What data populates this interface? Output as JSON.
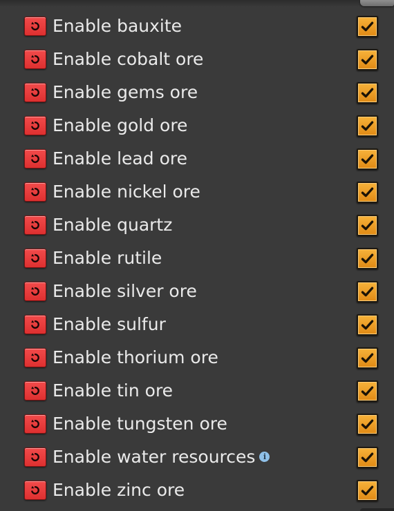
{
  "settings": {
    "rows": [
      {
        "label": "Enable bauxite",
        "checked": true,
        "info_icon": false
      },
      {
        "label": "Enable cobalt ore",
        "checked": true,
        "info_icon": false
      },
      {
        "label": "Enable gems ore",
        "checked": true,
        "info_icon": false
      },
      {
        "label": "Enable gold ore",
        "checked": true,
        "info_icon": false
      },
      {
        "label": "Enable lead ore",
        "checked": true,
        "info_icon": false
      },
      {
        "label": "Enable nickel ore",
        "checked": true,
        "info_icon": false
      },
      {
        "label": "Enable quartz",
        "checked": true,
        "info_icon": false
      },
      {
        "label": "Enable rutile",
        "checked": true,
        "info_icon": false
      },
      {
        "label": "Enable silver ore",
        "checked": true,
        "info_icon": false
      },
      {
        "label": "Enable sulfur",
        "checked": true,
        "info_icon": false
      },
      {
        "label": "Enable thorium ore",
        "checked": true,
        "info_icon": false
      },
      {
        "label": "Enable tin ore",
        "checked": true,
        "info_icon": false
      },
      {
        "label": "Enable tungsten ore",
        "checked": true,
        "info_icon": false
      },
      {
        "label": "Enable water resources",
        "checked": true,
        "info_icon": true,
        "info_glyph": "i"
      },
      {
        "label": "Enable zinc ore",
        "checked": true,
        "info_icon": false
      }
    ]
  },
  "icons": {
    "reset": "reset-icon",
    "check": "checkmark-icon",
    "info": "info-icon"
  },
  "colors": {
    "panel_bg": "#3a3a3a",
    "reset_red": "#e83c3c",
    "checkbox_orange": "#f0a02a",
    "label_text": "#eaeaea",
    "info_blue": "#8fc0e8"
  }
}
